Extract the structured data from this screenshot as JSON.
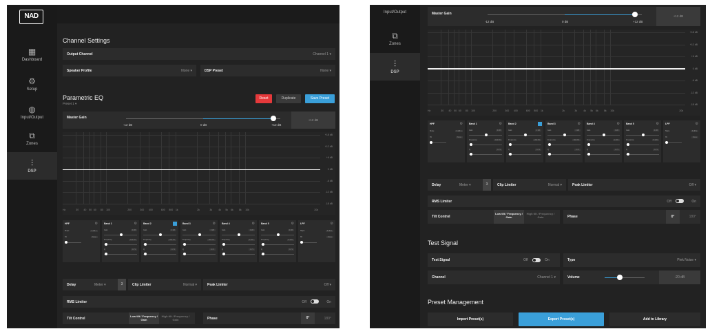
{
  "colors": {
    "accent": "#3a9fd9",
    "reset": "#e5393b"
  },
  "sidebar": {
    "logo": "NAD",
    "items": [
      {
        "icon": "dashboard-icon",
        "glyph": "▦",
        "label": "Dashboard"
      },
      {
        "icon": "gear-icon",
        "glyph": "⚙",
        "label": "Setup"
      },
      {
        "icon": "input-output-icon",
        "glyph": "◍",
        "label": "Input/Output"
      },
      {
        "icon": "zones-icon",
        "glyph": "⧉",
        "label": "Zones"
      },
      {
        "icon": "dsp-icon",
        "glyph": "⫶",
        "label": "DSP"
      }
    ],
    "active": "DSP"
  },
  "channel_settings": {
    "title": "Channel Settings",
    "output_channel": {
      "label": "Output Channel",
      "value": "Channel 1 ▾"
    },
    "speaker_profile": {
      "label": "Speaker Profile",
      "value": "None ▾"
    },
    "dsp_preset": {
      "label": "DSP Preset",
      "value": "None ▾"
    }
  },
  "eq": {
    "title": "Parametric EQ",
    "preset": "Preset 1 ▾",
    "reset": "Reset",
    "duplicate": "Duplicate",
    "save_preset": "Save Preset",
    "master_gain": {
      "label": "Master Gain",
      "min": "-12 dB",
      "mid": "0 dB",
      "max": "+12 dB",
      "value_box": "+12 dB",
      "level": 0.92
    },
    "db_labels": [
      "+18 dB",
      "+12 dB",
      "+6 dB",
      "0 dB",
      "-6 dB",
      "-12 dB",
      "-18 dB"
    ],
    "freq_labels": [
      "Hz",
      "30",
      "40",
      "50",
      "60",
      "80",
      "100",
      "200",
      "300",
      "400",
      "600",
      "800",
      "1k",
      "2k",
      "3k",
      "4k",
      "5k",
      "6k",
      "8k",
      "10k",
      "20k"
    ],
    "bands": [
      {
        "title": "HPF",
        "kind": "pass",
        "field_a": "Slope",
        "val_a": "6 dB ▾",
        "field_b": "Hz",
        "val_b": "None"
      },
      {
        "title": "Band 1",
        "kind": "band",
        "field_a": "Gain",
        "val_a": "0 dB",
        "field_b": "Frequency",
        "val_b": "100 Hz",
        "field_c": "Q",
        "val_c": "0.71"
      },
      {
        "title": "Band 2",
        "kind": "band",
        "field_a": "Gain",
        "val_a": "0 dB",
        "field_b": "Frequency",
        "val_b": "200 Hz",
        "field_c": "Q",
        "val_c": "0.71",
        "selected": true
      },
      {
        "title": "Band 3",
        "kind": "band",
        "field_a": "Gain",
        "val_a": "0 dB",
        "field_b": "Frequency",
        "val_b": "500 Hz",
        "field_c": "Q",
        "val_c": "0.71"
      },
      {
        "title": "Band 4",
        "kind": "band",
        "field_a": "Gain",
        "val_a": "0 dB",
        "field_b": "Frequency",
        "val_b": "1 kHz",
        "field_c": "Q",
        "val_c": "0.71"
      },
      {
        "title": "Band 5",
        "kind": "band",
        "field_a": "Gain",
        "val_a": "0 dB",
        "field_b": "Frequency",
        "val_b": "5 kHz",
        "field_c": "Q",
        "val_c": "0.71"
      },
      {
        "title": "LPF",
        "kind": "pass",
        "field_a": "Slope",
        "val_a": "6 dB ▾",
        "field_b": "Hz",
        "val_b": "None"
      }
    ]
  },
  "delay": {
    "label": "Delay",
    "unit": "Meter ▾",
    "value": "3"
  },
  "clip_limiter": {
    "label": "Clip Limiter",
    "value": "Normal ▾"
  },
  "peak_limiter": {
    "label": "Peak Limiter",
    "value": "Off ▾"
  },
  "rms_limiter": {
    "label": "RMS Limiter",
    "off": "Off",
    "on": "On"
  },
  "tilt_control": {
    "label": "Tilt Control",
    "opt1": "Low tilt / Frequency / Gain",
    "opt2": "High tilt / Frequency / Gain"
  },
  "phase": {
    "label": "Phase",
    "opt1": "0°",
    "opt2": "180°"
  },
  "test_signal": {
    "title": "Test Signal",
    "toggle": {
      "label": "Test Signal",
      "off": "Off",
      "on": "On"
    },
    "type": {
      "label": "Type",
      "value": "Pink Noise ▾"
    },
    "channel": {
      "label": "Channel",
      "value": "Channel 1 ▾"
    },
    "volume": {
      "label": "Volume",
      "value": "-20 dB",
      "level": 0.35
    }
  },
  "preset_mgmt": {
    "title": "Preset Management",
    "import": "Import Preset(s)",
    "export": "Export Preset(s)",
    "add": "Add to Library"
  }
}
